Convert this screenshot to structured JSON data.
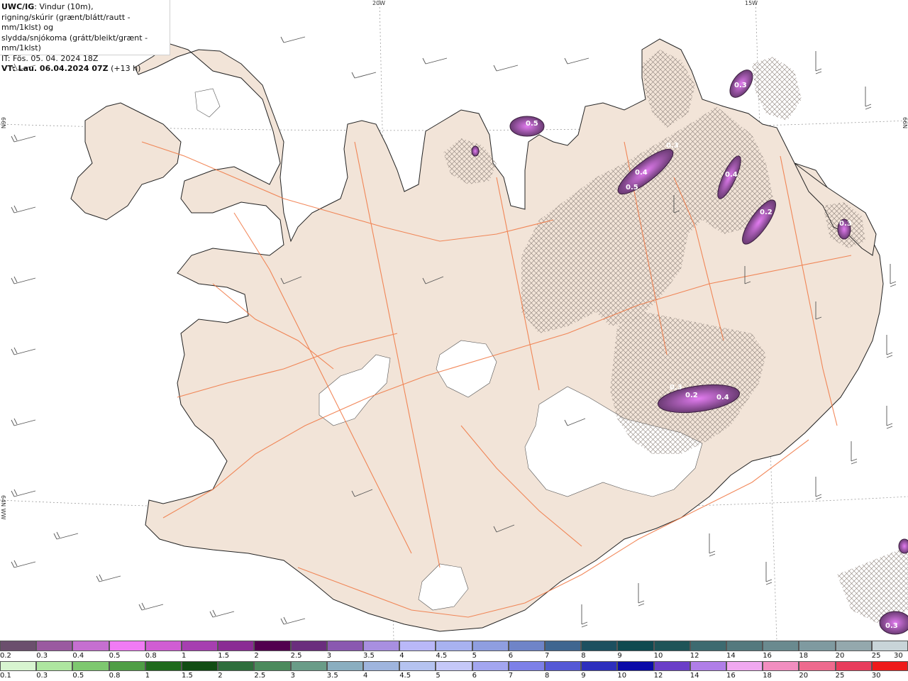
{
  "title": {
    "model": "UWC/IG",
    "line1_rest": ": Vindur (10m),",
    "line2": "rigning/skúrir (grænt/blátt/rautt - mm/1klst) og",
    "line3": "slydda/snjókoma (grátt/bleikt/grænt - mm/1klst)",
    "it": "IT: Fös. 05. 04. 2024 18Z",
    "vt_bold": "VT: Lau. 06.04.2024 07Z",
    "vt_rest": " (+13 h)"
  },
  "graticule": {
    "lon_20w": "20W",
    "lon_15w": "15W",
    "lat_66n_left": "66N",
    "lat_66n_right": "66N",
    "lat_64n_left": "64N WW"
  },
  "precip_labels": [
    "0.5",
    "0.3",
    "0.4",
    "0.5",
    "0.2",
    "0.4",
    "0.3",
    "0.2",
    "0.3",
    "0.3",
    "0.4",
    "0.3"
  ],
  "legend": {
    "snow": {
      "labels": [
        "0.2",
        "0.3",
        "0.4",
        "0.5",
        "0.8",
        "1",
        "1.5",
        "2",
        "2.5",
        "3",
        "3.5",
        "4",
        "4.5",
        "5",
        "6",
        "7",
        "8",
        "9",
        "10",
        "12",
        "14",
        "16",
        "18",
        "20",
        "25",
        "30"
      ],
      "colors": [
        "#6b4f6d",
        "#9a5aa0",
        "#c56fd0",
        "#f07bf4",
        "#d05dd3",
        "#a63fb0",
        "#8a2c94",
        "#52004f",
        "#6a2d7d",
        "#8a58b0",
        "#a88fe0",
        "#b9b8f8",
        "#a8b2f0",
        "#8f9ee0",
        "#6f84c8",
        "#3f6690",
        "#1d5060",
        "#0f4a50",
        "#1f5458",
        "#3d6a70",
        "#54797e",
        "#6a8a8f",
        "#7f9aa0",
        "#94a8ad",
        "#c8d4d8"
      ]
    },
    "rain": {
      "labels": [
        "0.1",
        "0.3",
        "0.5",
        "0.8",
        "1",
        "1.5",
        "2",
        "2.5",
        "3",
        "3.5",
        "4",
        "4.5",
        "5",
        "6",
        "7",
        "8",
        "9",
        "10",
        "12",
        "14",
        "16",
        "18",
        "20",
        "25",
        "30"
      ],
      "colors": [
        "#d8f5d0",
        "#aee6a0",
        "#7ec870",
        "#4f9e45",
        "#1f6a1c",
        "#114d14",
        "#2e6e3c",
        "#4b8a5c",
        "#6a9c88",
        "#8aaec0",
        "#9fb5de",
        "#b5c3f0",
        "#c5c8f8",
        "#a3a6f0",
        "#7d80e8",
        "#5559d6",
        "#2d2fbe",
        "#0a0aa8",
        "#6a3ec8",
        "#b07ee8",
        "#f0a8f0",
        "#f28ec0",
        "#ee6a8e",
        "#e83c5c",
        "#ee1a1a"
      ]
    }
  }
}
